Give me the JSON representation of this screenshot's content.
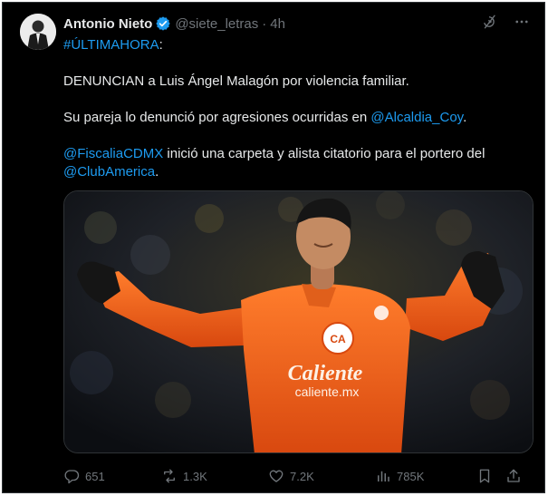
{
  "author": {
    "name": "Antonio Nieto",
    "handle": "@siete_letras",
    "separator": "·",
    "time": "4h"
  },
  "tweet": {
    "line1_tag": "#ÚLTIMAHORA",
    "line1_rest": ":",
    "line2": "DENUNCIAN a Luis Ángel Malagón por violencia familiar.",
    "line3_text": "Su pareja lo denunció por agresiones ocurridas en ",
    "line3_mention": "@Alcaldia_Coy",
    "line3_end": ".",
    "line4_mention1": "@FiscaliaCDMX",
    "line4_text": " inició una carpeta y alista citatorio para el portero del",
    "line4_mention2": "@ClubAmerica",
    "line4_end": "."
  },
  "media": {
    "shirt_crest_text": "CA",
    "sponsor_main": "Caliente",
    "sponsor_sub": "caliente.mx"
  },
  "stats": {
    "replies": "651",
    "retweets": "1.3K",
    "likes": "7.2K",
    "views": "785K"
  },
  "icons": {
    "verified": "verified-badge-icon",
    "grok": "grok-icon",
    "more": "more-icon",
    "reply": "reply-icon",
    "retweet": "retweet-icon",
    "like": "heart-icon",
    "views": "views-icon",
    "bookmark": "bookmark-icon",
    "share": "share-icon"
  },
  "colors": {
    "background": "#000000",
    "text": "#e7e9ea",
    "muted": "#71767b",
    "link": "#1d9bf0",
    "jersey": "#f26522"
  }
}
